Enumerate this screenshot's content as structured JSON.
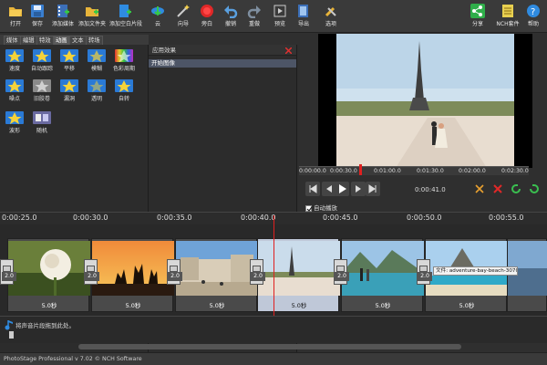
{
  "toolbar": {
    "open": "打开",
    "save": "保存",
    "add_media": "添加媒体",
    "add_folder": "添加文件夹",
    "add_blank": "添加空白片段",
    "cloud": "云",
    "wizard": "向导",
    "record": "旁白",
    "undo": "撤销",
    "redo": "重做",
    "preview": "预览",
    "export": "导出",
    "options": "选项",
    "share": "分享",
    "nch_suite": "NCH套件",
    "help": "帮助"
  },
  "tabs": [
    "媒体",
    "编辑",
    "特效",
    "动画",
    "文本",
    "转场"
  ],
  "active_tab": "动画",
  "effects": [
    {
      "label": "速度",
      "color": "#2a7ad6"
    },
    {
      "label": "自动跟踪",
      "color": "#2a7ad6"
    },
    {
      "label": "平移",
      "color": "#2a7ad6"
    },
    {
      "label": "模糊",
      "color": "#2a7ad6"
    },
    {
      "label": "色彩周期",
      "color": "#c83ac8"
    },
    {
      "label": "噪点",
      "color": "#2a7ad6"
    },
    {
      "label": "旧胶卷",
      "color": "#8a8a8a"
    },
    {
      "label": "漏洞",
      "color": "#2a7ad6"
    },
    {
      "label": "透明",
      "color": "#2a7ad6"
    },
    {
      "label": "自转",
      "color": "#2a7ad6"
    },
    {
      "label": "波形",
      "color": "#2a7ad6"
    },
    {
      "label": "随机",
      "color": "#6a6aa0"
    }
  ],
  "applied_panel": {
    "title": "应用效果",
    "item": "开始图像"
  },
  "preview": {
    "ruler_ticks": [
      "0:00:00.0",
      "0:00:30.0",
      "0:01:00.0",
      "0:01:30.0",
      "0:02:00.0",
      "0:02:30.0"
    ],
    "time": "0:00:41.0",
    "autoplay_label": "自动播放",
    "autoplay_checked": true
  },
  "timeline": {
    "ticks": [
      "0:00:25.0",
      "0:00:30.0",
      "0:00:35.0",
      "0:00:40.0",
      "0:00:45.0",
      "0:00:50.0",
      "0:00:55.0"
    ],
    "clips": [
      {
        "duration": "5.0秒",
        "scene": "rose"
      },
      {
        "duration": "5.0秒",
        "scene": "sunset-jump"
      },
      {
        "duration": "5.0秒",
        "scene": "street"
      },
      {
        "duration": "5.0秒",
        "scene": "eiffel",
        "selected": true
      },
      {
        "duration": "5.0秒",
        "scene": "lake"
      },
      {
        "duration": "5.0秒",
        "scene": "beach"
      },
      {
        "duration": "",
        "scene": "partial"
      }
    ],
    "transitions": [
      "2.0",
      "2.0",
      "2.0",
      "2.0",
      "2.0",
      "2.0"
    ],
    "tooltip": "文件: adventure-bay-beach-307008.jpg",
    "audio_hint": "将声音片段拖到此处。"
  },
  "status": "PhotoStage Professional v 7.02 © NCH Software",
  "colors": {
    "toolbar_bg": "#3a3a3a",
    "panel_bg": "#2c2c2c",
    "selected_item": "#4d5566",
    "playhead": "#e02020"
  }
}
